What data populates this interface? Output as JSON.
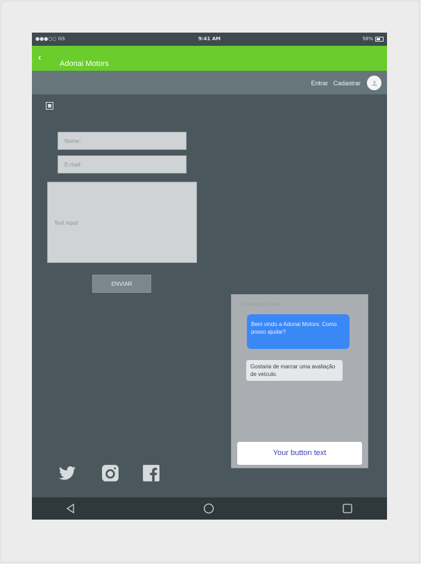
{
  "status_bar": {
    "carrier": "●●●○○ GS",
    "time": "9:41 AM",
    "battery": "58%"
  },
  "app_bar": {
    "title": "Adonai Motors",
    "back_icon": "chevron-left-icon",
    "color": "#6acd2c"
  },
  "user_bar": {
    "login": "Entrar",
    "signup": "Cadastrar",
    "avatar_icon": "user-icon"
  },
  "form": {
    "name_placeholder": "Nome:",
    "email_placeholder": "E-mail:",
    "message_placeholder": "Text input",
    "send_label": "ENVIAR"
  },
  "social": {
    "icons": [
      "twitter-icon",
      "instagram-icon",
      "facebook-icon"
    ]
  },
  "chat": {
    "header": "Estamos Online",
    "bot_message": "Bem vindo a Adonai Motors. Como posso ajudar?",
    "user_message": "Gostaria de marcar uma avaliação de veículo.",
    "button_text": "Your button text",
    "bot_color": "#3a88f5"
  },
  "nav": {
    "icons": [
      "back-triangle-icon",
      "home-circle-icon",
      "recent-square-icon"
    ]
  }
}
